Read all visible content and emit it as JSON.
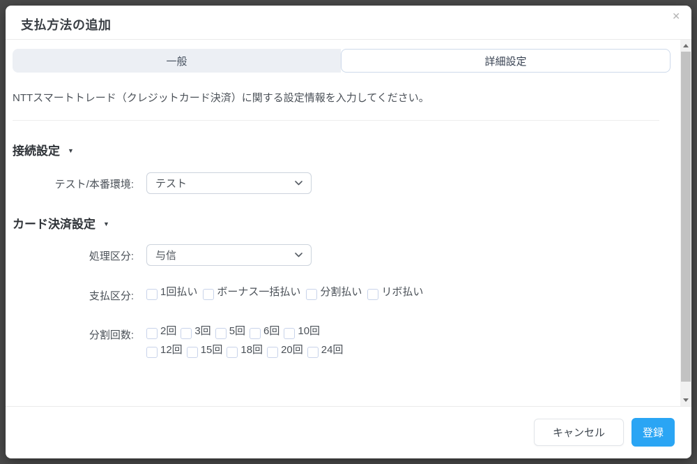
{
  "modal": {
    "title": "支払方法の追加"
  },
  "icons": {
    "close": "✕",
    "caret_down": "▼"
  },
  "tabs": {
    "general": "一般",
    "advanced": "詳細設定"
  },
  "description": "NTTスマートトレード（クレジットカード決済）に関する設定情報を入力してください。",
  "connection_section": {
    "title": "接続設定",
    "env_label": "テスト/本番環境:",
    "env_value": "テスト"
  },
  "card_section": {
    "title": "カード決済設定",
    "processing_label": "処理区分:",
    "processing_value": "与信",
    "payment_label": "支払区分:",
    "payment_options": [
      "1回払い",
      "ボーナス一括払い",
      "分割払い",
      "リボ払い"
    ],
    "installments_label": "分割回数:",
    "installments_row1": [
      "2回",
      "3回",
      "5回",
      "6回",
      "10回"
    ],
    "installments_row2": [
      "12回",
      "15回",
      "18回",
      "20回",
      "24回"
    ]
  },
  "footer": {
    "cancel": "キャンセル",
    "submit": "登録"
  },
  "colors": {
    "accent": "#2aa5f4",
    "backdrop": "#4a4a4a",
    "tab_inactive_bg": "#eceff4",
    "tab_active_border": "#cdd9ea",
    "scroll_thumb": "#c2c2c2"
  }
}
